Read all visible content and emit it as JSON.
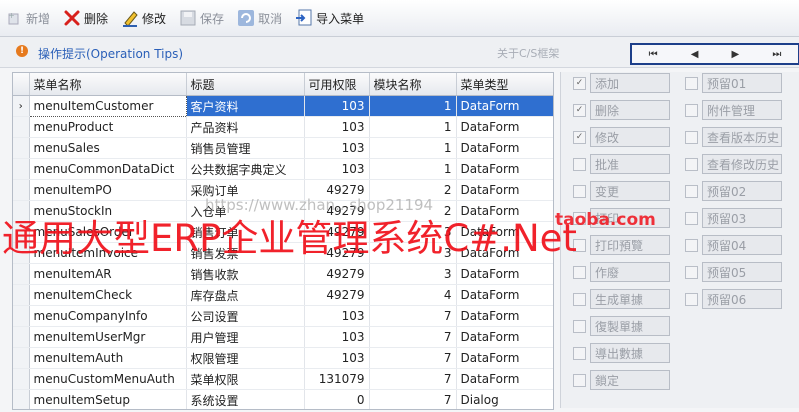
{
  "toolbar": {
    "buttons": [
      {
        "label": "新增",
        "icon": "add-icon",
        "enabled": false
      },
      {
        "label": "删除",
        "icon": "delete-x-icon",
        "enabled": true
      },
      {
        "label": "修改",
        "icon": "edit-pencil-icon",
        "enabled": true
      },
      {
        "label": "保存",
        "icon": "save-disk-icon",
        "enabled": false
      },
      {
        "label": "取消",
        "icon": "undo-icon",
        "enabled": false
      },
      {
        "label": "导入菜单",
        "icon": "import-icon",
        "enabled": true
      }
    ]
  },
  "tips": {
    "label": "操作提示(Operation Tips)",
    "about": "关于C/S框架"
  },
  "nav": {
    "first": "⏮",
    "prev": "◀",
    "next": "▶",
    "last": "⏭"
  },
  "grid": {
    "columns": [
      "菜单名称",
      "标题",
      "可用权限",
      "模块名称",
      "菜单类型"
    ],
    "rows": [
      [
        "menuItemCustomer",
        "客户资料",
        "103",
        "1",
        "DataForm"
      ],
      [
        "menuProduct",
        "产品资料",
        "103",
        "1",
        "DataForm"
      ],
      [
        "menuSales",
        "销售员管理",
        "103",
        "1",
        "DataForm"
      ],
      [
        "menuCommonDataDict",
        "公共数据字典定义",
        "103",
        "1",
        "DataForm"
      ],
      [
        "menuItemPO",
        "采购订单",
        "49279",
        "2",
        "DataForm"
      ],
      [
        "menuStockIn",
        "入仓单",
        "49279",
        "2",
        "DataForm"
      ],
      [
        "menuSalesOrder",
        "销售订单",
        "49279",
        "3",
        "DataForm"
      ],
      [
        "menuItemInvoice",
        "销售发票",
        "49279",
        "3",
        "DataForm"
      ],
      [
        "menuItemAR",
        "销售收款",
        "49279",
        "3",
        "DataForm"
      ],
      [
        "menuItemCheck",
        "库存盘点",
        "49279",
        "4",
        "DataForm"
      ],
      [
        "menuCompanyInfo",
        "公司设置",
        "103",
        "7",
        "DataForm"
      ],
      [
        "menuItemUserMgr",
        "用户管理",
        "103",
        "7",
        "DataForm"
      ],
      [
        "menuItemAuth",
        "权限管理",
        "103",
        "7",
        "DataForm"
      ],
      [
        "menuCustomMenuAuth",
        "菜单权限",
        "131079",
        "7",
        "DataForm"
      ],
      [
        "menuItemSetup",
        "系统设置",
        "0",
        "7",
        "Dialog"
      ]
    ],
    "row_indicator": "›"
  },
  "permissions": {
    "left": [
      {
        "label": "添加",
        "checked": true
      },
      {
        "label": "删除",
        "checked": true
      },
      {
        "label": "修改",
        "checked": true
      },
      {
        "label": "批准",
        "checked": false
      },
      {
        "label": "变更",
        "checked": false
      },
      {
        "label": "打印",
        "checked": false
      },
      {
        "label": "打印預覽",
        "checked": false
      },
      {
        "label": "作廢",
        "checked": false
      },
      {
        "label": "生成單據",
        "checked": false
      },
      {
        "label": "復製單據",
        "checked": false
      },
      {
        "label": "導出數據",
        "checked": false
      },
      {
        "label": "鎖定",
        "checked": false
      }
    ],
    "right": [
      {
        "label": "预留01",
        "checked": false
      },
      {
        "label": "附件管理",
        "checked": false
      },
      {
        "label": "查看版本历史",
        "checked": false
      },
      {
        "label": "查看修改历史",
        "checked": false
      },
      {
        "label": "预留02",
        "checked": false
      },
      {
        "label": "预留03",
        "checked": false
      },
      {
        "label": "预留04",
        "checked": false
      },
      {
        "label": "预留05",
        "checked": false
      },
      {
        "label": "预留06",
        "checked": false
      }
    ]
  },
  "watermarks": {
    "main": "通用大型ERP企业管理系统C#.Net",
    "shop": "taoba.com",
    "url": "https://www.zhan...shop21194"
  }
}
